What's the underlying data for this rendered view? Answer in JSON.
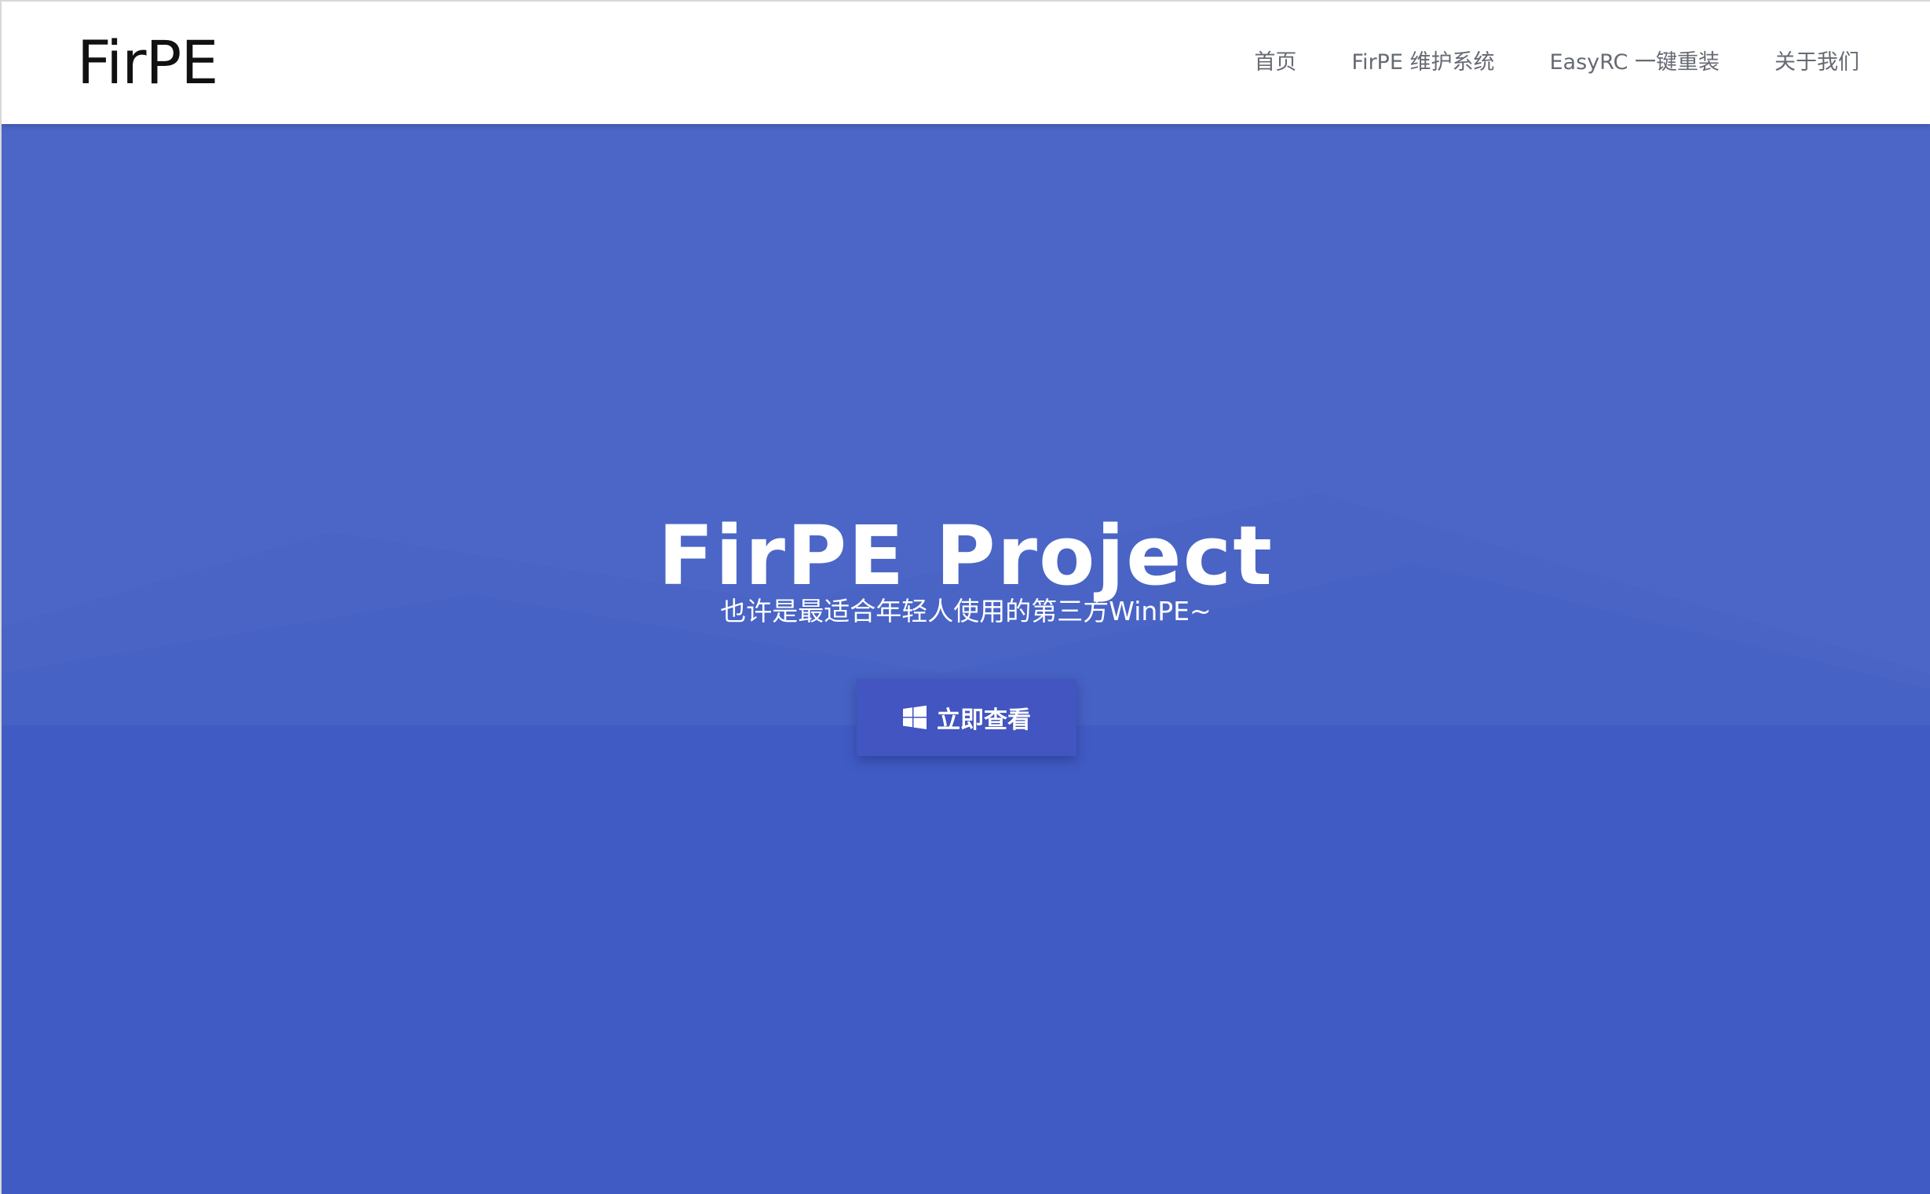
{
  "header": {
    "logo": "FirPE",
    "nav": [
      {
        "label": "首页"
      },
      {
        "label": "FirPE 维护系统"
      },
      {
        "label": "EasyRC 一键重装"
      },
      {
        "label": "关于我们"
      }
    ]
  },
  "hero": {
    "title": "FirPE Project",
    "subtitle": "也许是最适合年轻人使用的第三方WinPE~",
    "button": {
      "label": "立即查看",
      "icon": "windows-icon"
    }
  },
  "colors": {
    "nav_bg": "#ffffff",
    "hero_bg": "#405bc4",
    "hero_top": "#4b66c6",
    "button_bg": "#4255c0",
    "nav_text": "#666a73",
    "logo_text": "#111111"
  }
}
